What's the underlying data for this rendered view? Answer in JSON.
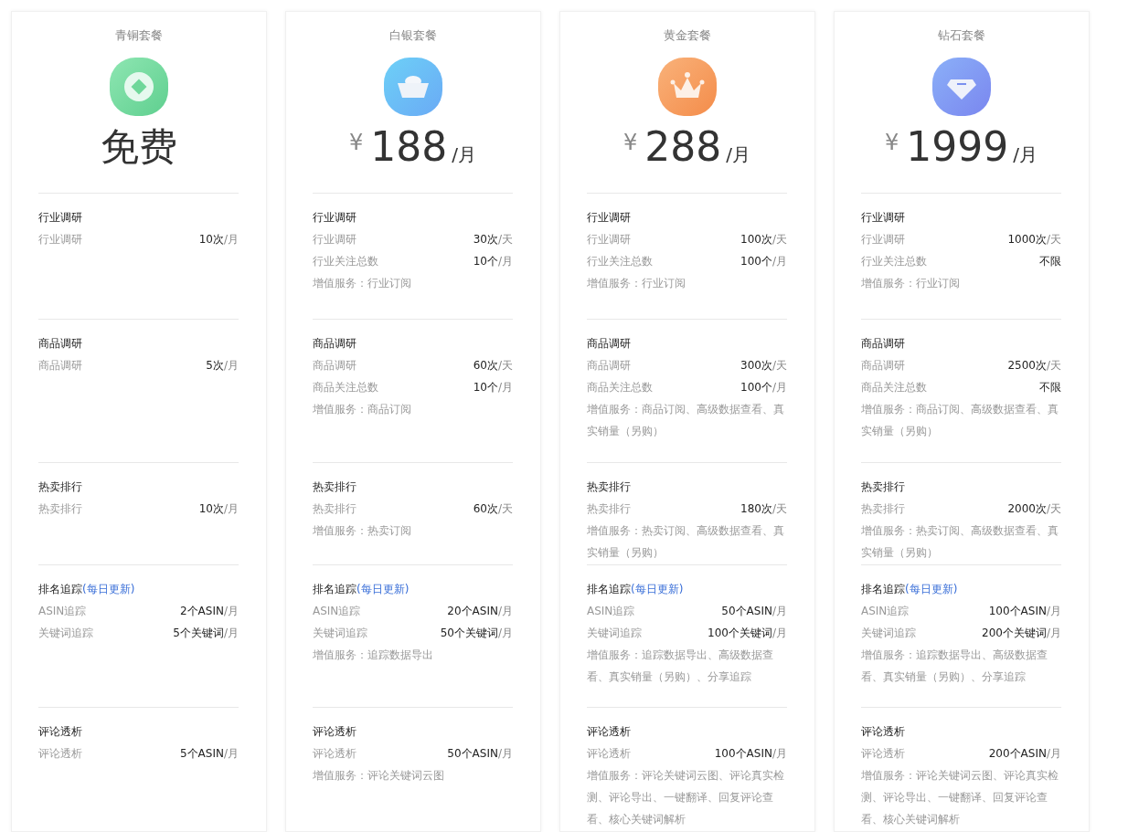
{
  "plans": [
    {
      "name": "青铜套餐",
      "price": {
        "amount": "免费"
      },
      "sections": [
        {
          "title": "行业调研",
          "rows": [
            {
              "label": "行业调研",
              "amount": "10次",
              "unit": "/月"
            }
          ]
        },
        {
          "title": "商品调研",
          "rows": [
            {
              "label": "商品调研",
              "amount": "5次",
              "unit": "/月"
            }
          ]
        },
        {
          "title": "热卖排行",
          "rows": [
            {
              "label": "热卖排行",
              "amount": "10次",
              "unit": "/月"
            }
          ]
        },
        {
          "title": "排名追踪",
          "note": "(每日更新)",
          "rows": [
            {
              "label": "ASIN追踪",
              "amount": "2个ASIN",
              "unit": "/月"
            },
            {
              "label": "关键词追踪",
              "amount": "5个关键词",
              "unit": "/月"
            }
          ]
        },
        {
          "title": "评论透析",
          "rows": [
            {
              "label": "评论透析",
              "amount": "5个ASIN",
              "unit": "/月"
            }
          ]
        }
      ]
    },
    {
      "name": "白银套餐",
      "price": {
        "currency": "¥",
        "amount": "188",
        "period": "/月"
      },
      "sections": [
        {
          "title": "行业调研",
          "rows": [
            {
              "label": "行业调研",
              "amount": "30次",
              "unit": "/天"
            },
            {
              "label": "行业关注总数",
              "amount": "10个",
              "unit": "/月"
            }
          ],
          "extra": "增值服务：行业订阅"
        },
        {
          "title": "商品调研",
          "rows": [
            {
              "label": "商品调研",
              "amount": "60次",
              "unit": "/天"
            },
            {
              "label": "商品关注总数",
              "amount": "10个",
              "unit": "/月"
            }
          ],
          "extra": "增值服务：商品订阅"
        },
        {
          "title": "热卖排行",
          "rows": [
            {
              "label": "热卖排行",
              "amount": "60次",
              "unit": "/天"
            }
          ],
          "extra": "增值服务：热卖订阅"
        },
        {
          "title": "排名追踪",
          "note": "(每日更新)",
          "rows": [
            {
              "label": "ASIN追踪",
              "amount": "20个ASIN",
              "unit": "/月"
            },
            {
              "label": "关键词追踪",
              "amount": "50个关键词",
              "unit": "/月"
            }
          ],
          "extra": "增值服务：追踪数据导出"
        },
        {
          "title": "评论透析",
          "rows": [
            {
              "label": "评论透析",
              "amount": "50个ASIN",
              "unit": "/月"
            }
          ],
          "extra": "增值服务：评论关键词云图"
        }
      ]
    },
    {
      "name": "黄金套餐",
      "price": {
        "currency": "¥",
        "amount": "288",
        "period": "/月"
      },
      "sections": [
        {
          "title": "行业调研",
          "rows": [
            {
              "label": "行业调研",
              "amount": "100次",
              "unit": "/天"
            },
            {
              "label": "行业关注总数",
              "amount": "100个",
              "unit": "/月"
            }
          ],
          "extra": "增值服务：行业订阅"
        },
        {
          "title": "商品调研",
          "rows": [
            {
              "label": "商品调研",
              "amount": "300次",
              "unit": "/天"
            },
            {
              "label": "商品关注总数",
              "amount": "100个",
              "unit": "/月"
            }
          ],
          "extra": "增值服务：商品订阅、高级数据查看、真实销量（另购）"
        },
        {
          "title": "热卖排行",
          "rows": [
            {
              "label": "热卖排行",
              "amount": "180次",
              "unit": "/天"
            }
          ],
          "extra": "增值服务：热卖订阅、高级数据查看、真实销量（另购）"
        },
        {
          "title": "排名追踪",
          "note": "(每日更新)",
          "rows": [
            {
              "label": "ASIN追踪",
              "amount": "50个ASIN",
              "unit": "/月"
            },
            {
              "label": "关键词追踪",
              "amount": "100个关键词",
              "unit": "/月"
            }
          ],
          "extra": "增值服务：追踪数据导出、高级数据查看、真实销量（另购）、分享追踪"
        },
        {
          "title": "评论透析",
          "rows": [
            {
              "label": "评论透析",
              "amount": "100个ASIN",
              "unit": "/月"
            }
          ],
          "extra": "增值服务：评论关键词云图、评论真实检测、评论导出、一键翻译、回复评论查看、核心关键词解析"
        }
      ]
    },
    {
      "name": "钻石套餐",
      "price": {
        "currency": "¥",
        "amount": "1999",
        "period": "/月"
      },
      "sections": [
        {
          "title": "行业调研",
          "rows": [
            {
              "label": "行业调研",
              "amount": "1000次",
              "unit": "/天"
            },
            {
              "label": "行业关注总数",
              "amount": "不限"
            }
          ],
          "extra": "增值服务：行业订阅"
        },
        {
          "title": "商品调研",
          "rows": [
            {
              "label": "商品调研",
              "amount": "2500次",
              "unit": "/天"
            },
            {
              "label": "商品关注总数",
              "amount": "不限"
            }
          ],
          "extra": "增值服务：商品订阅、高级数据查看、真实销量（另购）"
        },
        {
          "title": "热卖排行",
          "rows": [
            {
              "label": "热卖排行",
              "amount": "2000次",
              "unit": "/天"
            }
          ],
          "extra": "增值服务：热卖订阅、高级数据查看、真实销量（另购）"
        },
        {
          "title": "排名追踪",
          "note": "(每日更新)",
          "rows": [
            {
              "label": "ASIN追踪",
              "amount": "100个ASIN",
              "unit": "/月"
            },
            {
              "label": "关键词追踪",
              "amount": "200个关键词",
              "unit": "/月"
            }
          ],
          "extra": "增值服务：追踪数据导出、高级数据查看、真实销量（另购）、分享追踪"
        },
        {
          "title": "评论透析",
          "rows": [
            {
              "label": "评论透析",
              "amount": "200个ASIN",
              "unit": "/月"
            }
          ],
          "extra": "增值服务：评论关键词云图、评论真实检测、评论导出、一键翻译、回复评论查看、核心关键词解析"
        }
      ]
    }
  ]
}
